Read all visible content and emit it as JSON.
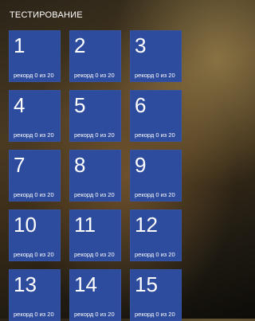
{
  "header": {
    "title": "ТЕСТИРОВАНИЕ"
  },
  "colors": {
    "tile_bg": "#2e4c9e",
    "text": "#ffffff"
  },
  "tiles": [
    {
      "number": "1",
      "record": "рекорд 0 из 20"
    },
    {
      "number": "2",
      "record": "рекорд 0 из 20"
    },
    {
      "number": "3",
      "record": "рекорд 0 из 20"
    },
    {
      "number": "4",
      "record": "рекорд 0 из 20"
    },
    {
      "number": "5",
      "record": "рекорд 0 из 20"
    },
    {
      "number": "6",
      "record": "рекорд 0 из 20"
    },
    {
      "number": "7",
      "record": "рекорд 0 из 20"
    },
    {
      "number": "8",
      "record": "рекорд 0 из 20"
    },
    {
      "number": "9",
      "record": "рекорд 0 из 20"
    },
    {
      "number": "10",
      "record": "рекорд 0 из 20"
    },
    {
      "number": "11",
      "record": "рекорд 0 из 20"
    },
    {
      "number": "12",
      "record": "рекорд 0 из 20"
    },
    {
      "number": "13",
      "record": "рекорд 0 из 20"
    },
    {
      "number": "14",
      "record": "рекорд 0 из 20"
    },
    {
      "number": "15",
      "record": "рекорд 0 из 20"
    }
  ]
}
